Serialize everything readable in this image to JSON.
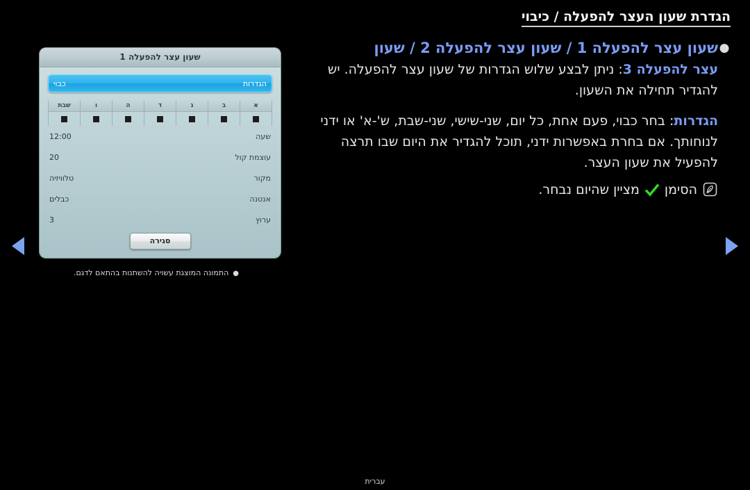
{
  "page": {
    "title": "הגדרת שעון העצר להפעלה / כיבוי",
    "footer_language": "עברית"
  },
  "content": {
    "bullet_marker": "●",
    "lead": "שעון עצר להפעלה 1 / שעון עצר להפעלה 2 / שעון",
    "para1_strong": "עצר להפעלה 3",
    "para1_rest": ": ניתן לבצע שלוש הגדרות של שעון עצר להפעלה.  יש להגדיר תחילה את השעון.",
    "para2_strong": "הגדרות",
    "para2_rest": ": בחר כבוי, פעם אחת, כל יום, שני-שישי, שני-שבת, ש'-א' או ידני לנוחותך. אם בחרת באפשרות ידני, תוכל להגדיר את היום שבו תרצה להפעיל את שעון העצר.",
    "note_icon": "note-pen-icon",
    "note_check": "check-icon",
    "note_text_before": "הסימן",
    "note_text_after": "מציין שהיום נבחר.",
    "accent_color": "#7b9cf5",
    "check_color": "#33dd22"
  },
  "osd": {
    "title": "שעון עצר להפעלה 1",
    "selected_row": {
      "label": "הגדרות",
      "value": "כבוי"
    },
    "days": [
      {
        "name": "א",
        "checked": true
      },
      {
        "name": "ב",
        "checked": true
      },
      {
        "name": "ג",
        "checked": true
      },
      {
        "name": "ד",
        "checked": true
      },
      {
        "name": "ה",
        "checked": true
      },
      {
        "name": "ו",
        "checked": true
      },
      {
        "name": "שבת",
        "checked": true
      }
    ],
    "rows": [
      {
        "label": "שעה",
        "value": "12:00"
      },
      {
        "label": "עוצמת קול",
        "value": "20"
      },
      {
        "label": "מקור",
        "value": "טלוויזיה"
      },
      {
        "label": "אנטנה",
        "value": "כבלים"
      },
      {
        "label": "ערוץ",
        "value": "3"
      }
    ],
    "close_label": "סגירה",
    "caption_marker": "●",
    "caption": "התמונה המוצגת עשויה להשתנות בהתאם לדגם.",
    "highlight_color": "#2fb5ee"
  },
  "nav": {
    "prev_icon": "triangle-left-icon",
    "next_icon": "triangle-right-icon",
    "arrow_color": "#7ba3f0"
  }
}
